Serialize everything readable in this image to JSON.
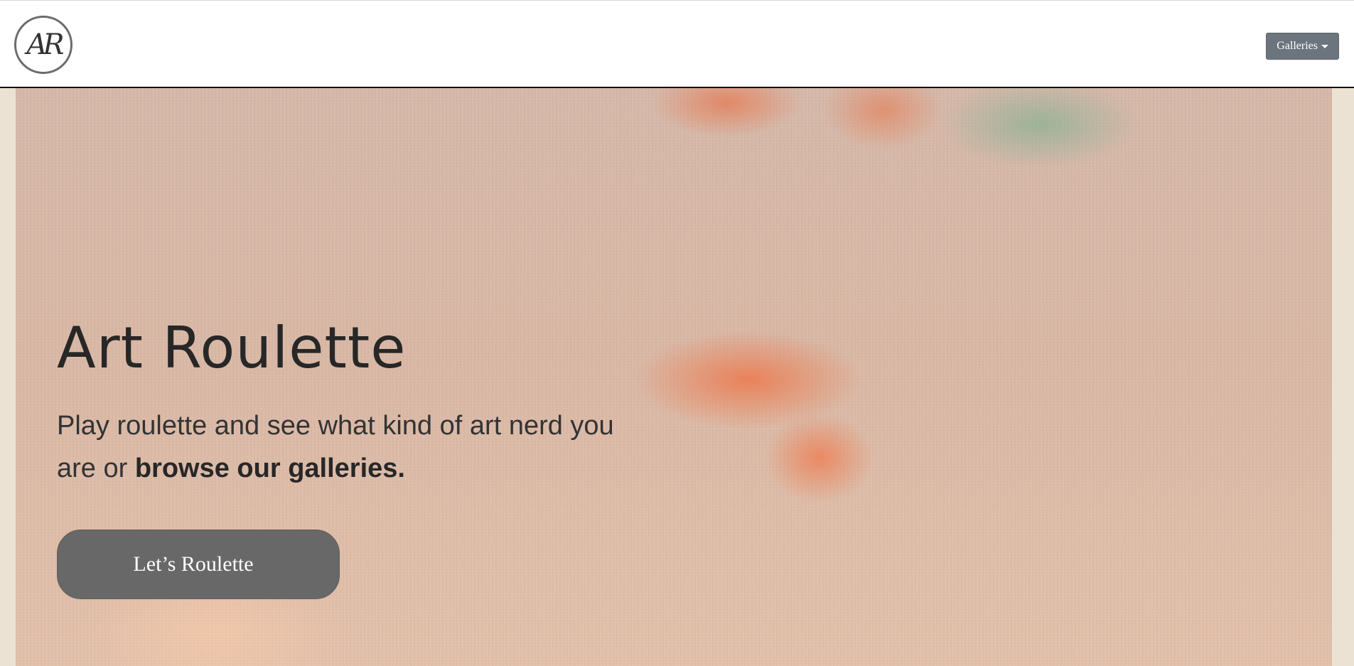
{
  "nav": {
    "logo_text": "AR",
    "galleries_label": "Galleries"
  },
  "hero": {
    "title": "Art Roulette",
    "subtitle_text": "Play roulette and see what kind of art nerd you are or ",
    "subtitle_link": "browse our galleries.",
    "cta_label": "Let’s Roulette"
  },
  "colors": {
    "button_gray": "#6c757d",
    "cta_gray": "#686868",
    "text_dark": "#272727"
  }
}
